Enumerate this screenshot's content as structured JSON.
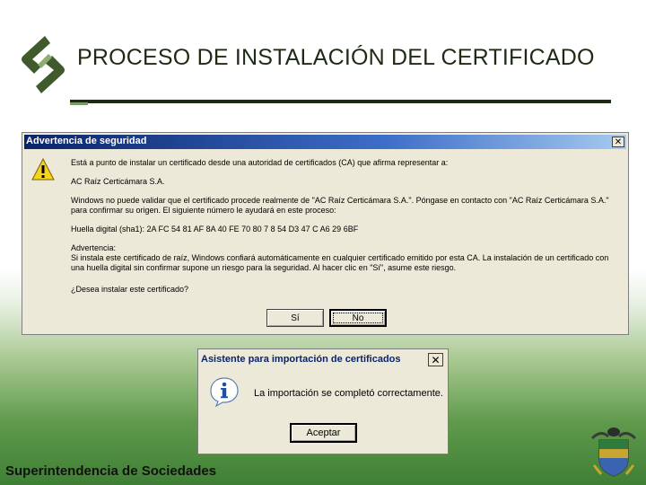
{
  "slide": {
    "title": "PROCESO DE INSTALACIÓN DEL CERTIFICADO",
    "footer": "Superintendencia de Sociedades"
  },
  "security_dialog": {
    "title": "Advertencia de seguridad",
    "close_glyph": "✕",
    "icon": "warning-icon",
    "lines": [
      "Está a punto de instalar un certificado desde una autoridad de certificados (CA) que afirma representar a:",
      "AC Raíz Certicámara S.A.",
      "Windows no puede validar que el certificado procede realmente de \"AC Raíz Certicámara S.A.\". Póngase en contacto con \"AC Raíz Certicámara S.A.\" para confirmar su origen. El siguiente número le ayudará en este proceso:",
      "Huella digital (sha1): 2A FC 54 81 AF 8A 40 FE 70 80 7 8 54 D3 47 C A6 29 6BF",
      "Advertencia:",
      "Si instala este certificado de raíz, Windows confiará automáticamente en cualquier certificado emitido por esta CA. La instalación de un certificado con una huella digital sin confirmar supone un riesgo para la seguridad. Al hacer clic en \"Sí\", asume este riesgo.",
      "¿Desea instalar este certificado?"
    ],
    "yes_label": "Sí",
    "no_label": "No"
  },
  "import_dialog": {
    "title": "Asistente para importación de certificados",
    "close_glyph": "✕",
    "icon": "info-icon",
    "message": "La importación se completó correctamente.",
    "ok_label": "Aceptar"
  },
  "colors": {
    "title_text": "#1f2a14",
    "dialog_bg": "#ece9d8",
    "titlebar_blue": "#0a246a",
    "footer_green": "#3f7f35"
  }
}
